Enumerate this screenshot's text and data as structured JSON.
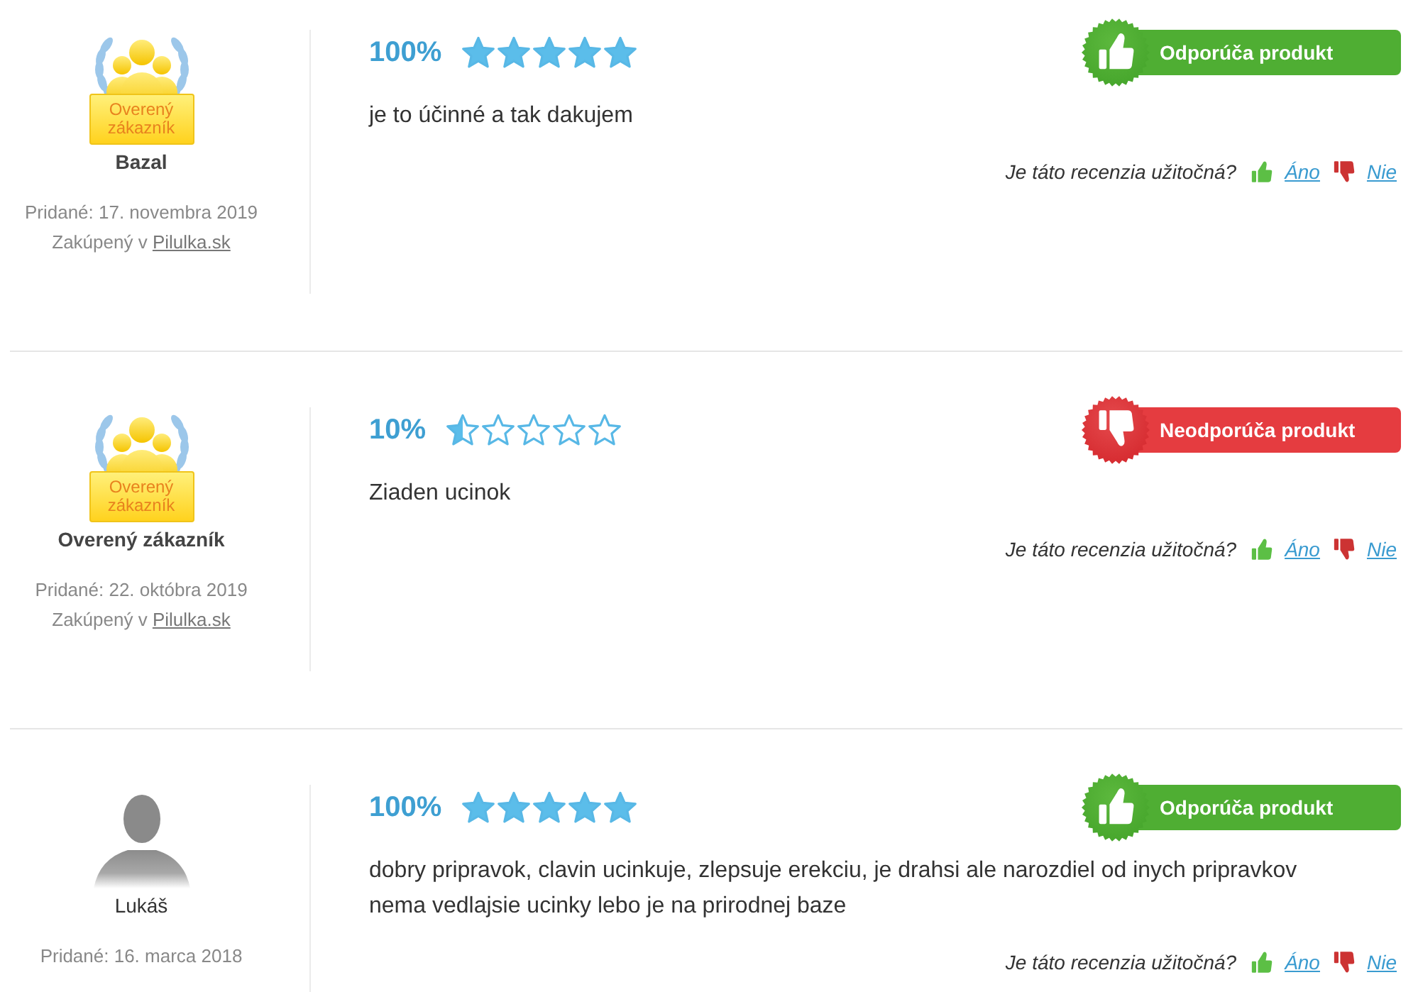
{
  "reviews": [
    {
      "avatar": {
        "kind": "verified",
        "label": "Overený zákazník"
      },
      "name": "Bazal",
      "added": "Pridané: 17. novembra 2019",
      "purchased": {
        "prefix": "Zakúpený v",
        "store": "Pilulka.sk"
      },
      "percent": "100%",
      "stars": 5,
      "recommendation": {
        "kind": "recommend",
        "label": "Odporúča produkt"
      },
      "text": "je to účinné a tak dakujem",
      "helpful": {
        "question": "Je táto recenzia užitočná?",
        "yes": "Áno",
        "no": "Nie"
      }
    },
    {
      "avatar": {
        "kind": "verified",
        "label": "Overený zákazník"
      },
      "name": "Overený zákazník",
      "added": "Pridané: 22. októbra 2019",
      "purchased": {
        "prefix": "Zakúpený v",
        "store": "Pilulka.sk"
      },
      "percent": "10%",
      "stars": 0.5,
      "recommendation": {
        "kind": "not_recommend",
        "label": "Neodporúča produkt"
      },
      "text": "Ziaden ucinok",
      "helpful": {
        "question": "Je táto recenzia užitočná?",
        "yes": "Áno",
        "no": "Nie"
      }
    },
    {
      "avatar": {
        "kind": "silhouette"
      },
      "name": "Lukáš",
      "added": "Pridané: 16. marca 2018",
      "percent": "100%",
      "stars": 5,
      "recommendation": {
        "kind": "recommend",
        "label": "Odporúča produkt"
      },
      "text": "dobry pripravok, clavin ucinkuje, zlepsuje erekciu, je drahsi ale narozdiel od inych pripravkov nema vedlajsie ucinky lebo je na prirodnej baze",
      "helpful": {
        "question": "Je táto recenzia užitočná?",
        "yes": "Áno",
        "no": "Nie"
      }
    }
  ]
}
